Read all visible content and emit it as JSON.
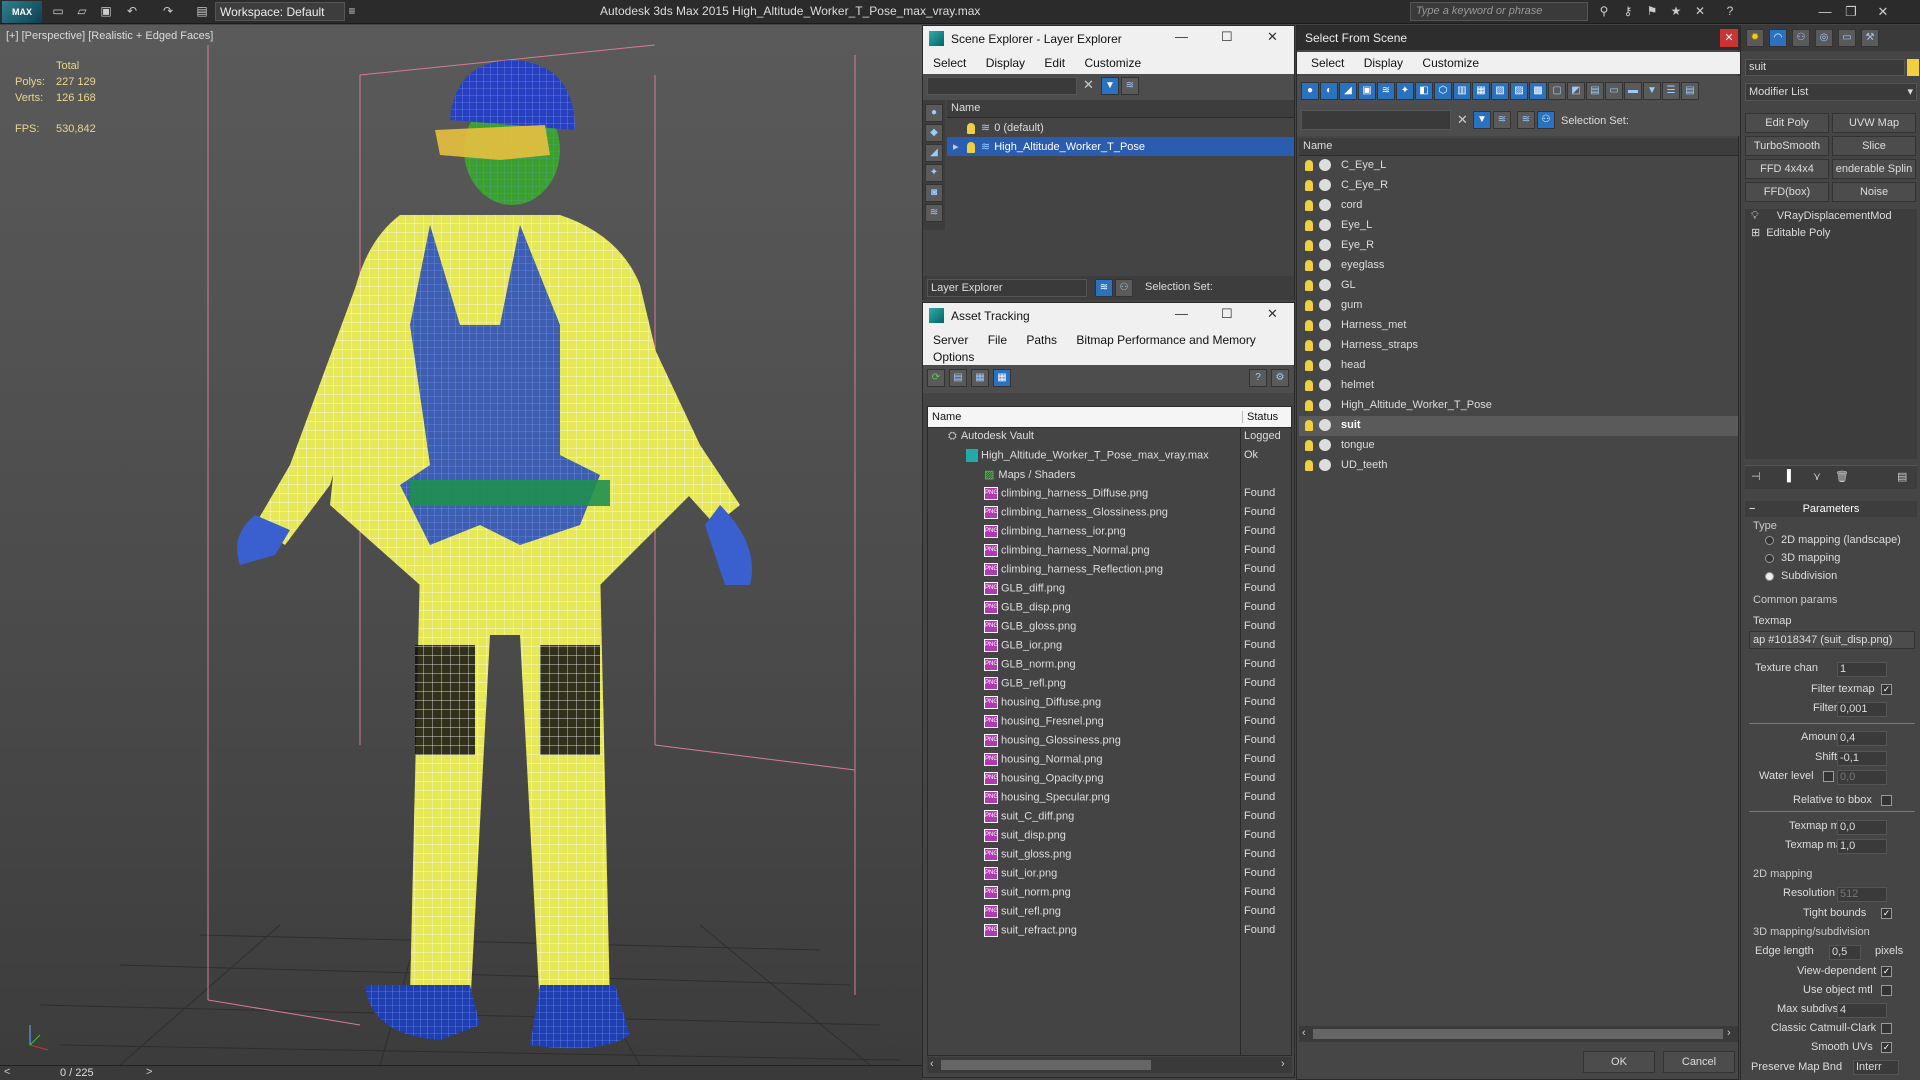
{
  "titlebar": {
    "app_icon": "3ds-max-logo",
    "logo": "MAX",
    "workspace": "Workspace: Default",
    "title": "Autodesk 3ds Max  2015    High_Altitude_Worker_T_Pose_max_vray.max",
    "search_placeholder": "Type a keyword or phrase"
  },
  "viewport": {
    "label": "[+] [Perspective] [Realistic + Edged Faces]",
    "total": "Total",
    "polys_label": "Polys:",
    "polys": "227 129",
    "verts_label": "Verts:",
    "verts": "126 168",
    "fps_label": "FPS:",
    "fps": "530,842",
    "time": "0 / 225"
  },
  "scene_explorer": {
    "title": "Scene Explorer - Layer Explorer",
    "menu": [
      "Select",
      "Display",
      "Edit",
      "Customize"
    ],
    "col_name": "Name",
    "rows": [
      "0 (default)",
      "High_Altitude_Worker_T_Pose"
    ],
    "footer_dropdown": "Layer Explorer",
    "selection_set": "Selection Set:"
  },
  "asset_tracking": {
    "title": "Asset Tracking",
    "menu": [
      "Server",
      "File",
      "Paths",
      "Bitmap Performance and Memory"
    ],
    "menu2": "Options",
    "col_name": "Name",
    "col_status": "Status",
    "vault": "Autodesk Vault",
    "vault_status": "Logged",
    "file": "High_Altitude_Worker_T_Pose_max_vray.max",
    "file_status": "Ok",
    "maps": "Maps / Shaders",
    "items": [
      "climbing_harness_Diffuse.png",
      "climbing_harness_Glossiness.png",
      "climbing_harness_ior.png",
      "climbing_harness_Normal.png",
      "climbing_harness_Reflection.png",
      "GLB_diff.png",
      "GLB_disp.png",
      "GLB_gloss.png",
      "GLB_ior.png",
      "GLB_norm.png",
      "GLB_refl.png",
      "housing_Diffuse.png",
      "housing_Fresnel.png",
      "housing_Glossiness.png",
      "housing_Normal.png",
      "housing_Opacity.png",
      "housing_Specular.png",
      "suit_C_diff.png",
      "suit_disp.png",
      "suit_gloss.png",
      "suit_ior.png",
      "suit_norm.png",
      "suit_refl.png",
      "suit_refract.png"
    ],
    "item_status": "Found"
  },
  "select_scene": {
    "title": "Select From Scene",
    "menu": [
      "Select",
      "Display",
      "Customize"
    ],
    "selection_set": "Selection Set:",
    "col_name": "Name",
    "objects": [
      "C_Eye_L",
      "C_Eye_R",
      "cord",
      "Eye_L",
      "Eye_R",
      "eyeglass",
      "GL",
      "gum",
      "Harness_met",
      "Harness_straps",
      "head",
      "helmet",
      "High_Altitude_Worker_T_Pose",
      "suit",
      "tongue",
      "UD_teeth"
    ],
    "selected": "suit",
    "ok": "OK",
    "cancel": "Cancel"
  },
  "command_panel": {
    "object_name": "suit",
    "modifier_list": "Modifier List",
    "buttons": [
      "Edit Poly",
      "UVW Map",
      "TurboSmooth",
      "Slice",
      "FFD 4x4x4",
      "enderable Splin",
      "FFD(box)",
      "Noise"
    ],
    "stack": [
      "VRayDisplacementMod",
      "Editable Poly"
    ],
    "rollout": "Parameters",
    "type_label": "Type",
    "types": [
      "2D mapping (landscape)",
      "3D mapping",
      "Subdivision"
    ],
    "common": "Common params",
    "texmap_label": "Texmap",
    "texmap": "ap #1018347 (suit_disp.png)",
    "fields": [
      {
        "label": "Texture chan",
        "value": "1"
      },
      {
        "label": "Filter blur",
        "value": "0,001"
      },
      {
        "label": "Amount",
        "value": "0,4"
      },
      {
        "label": "Shift",
        "value": "-0,1"
      },
      {
        "label": "Water level",
        "value": "0,0"
      },
      {
        "label": "Texmap min",
        "value": "0,0"
      },
      {
        "label": "Texmap max",
        "value": "1,0"
      },
      {
        "label": "Resolution",
        "value": "512"
      },
      {
        "label": "Edge length",
        "value": "0,5"
      },
      {
        "label": "Max subdivs",
        "value": "4"
      }
    ],
    "filter_texmap": "Filter texmap",
    "relative_bbox": "Relative to bbox",
    "grp2d": "2D mapping",
    "tight_bounds": "Tight bounds",
    "grp3d": "3D mapping/subdivision",
    "pixels": "pixels",
    "view_dependent": "View-dependent",
    "use_object_mtl": "Use object mtl",
    "classic_cc": "Classic Catmull-Clark",
    "smooth_uvs": "Smooth UVs",
    "preserve_map": "Preserve Map Bnd",
    "preserve_val": "Interr"
  },
  "colors": {
    "selection_blue": "#2a5db0",
    "suit_yellow": "#e6e85a",
    "harness_blue": "#2b4fb8",
    "wire_white": "#ffffff"
  }
}
